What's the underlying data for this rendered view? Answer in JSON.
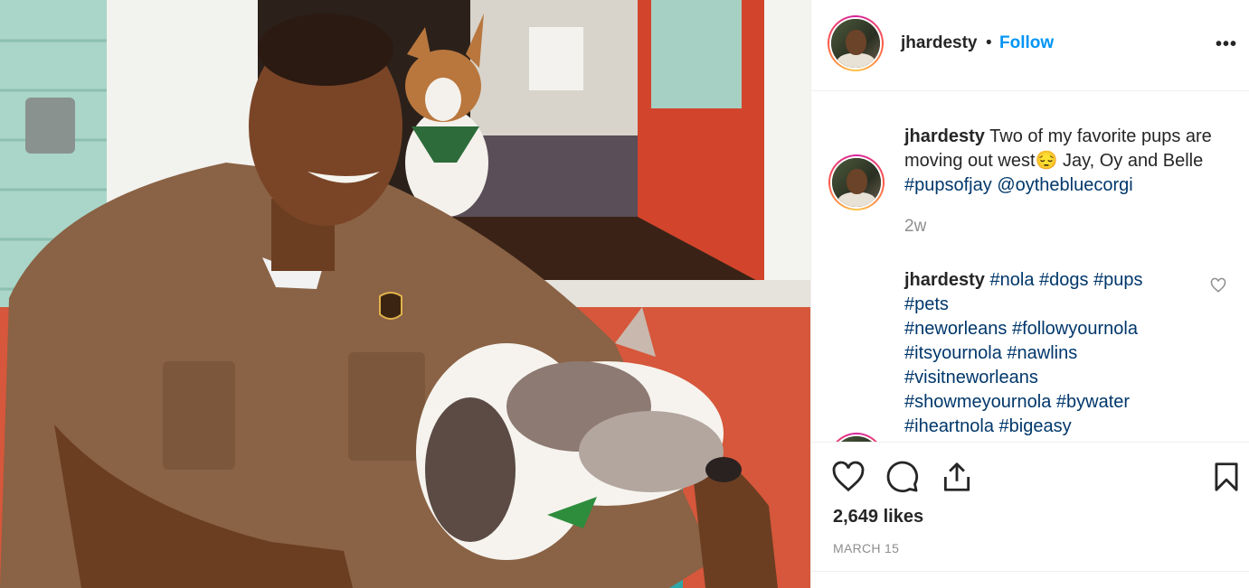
{
  "colors": {
    "link_blue": "#0095f6",
    "hashtag": "#00376b",
    "muted": "#8e8e8e",
    "text": "#262626"
  },
  "header": {
    "username": "jhardesty",
    "separator": "•",
    "follow_label": "Follow",
    "more_icon": "more-options-icon",
    "more_label": "•••"
  },
  "caption": {
    "username": "jhardesty",
    "text_part1": " Two of my favorite pups are moving out west",
    "emoji": "😔",
    "text_part2": " Jay, Oy and Belle ",
    "hashtag": "#pupsofjay",
    "mention": "@oythebluecorgi",
    "time": "2w"
  },
  "comment": {
    "username": "jhardesty",
    "tags": [
      "#nola",
      "#dogs",
      "#pups",
      "#pets",
      "#neworleans",
      "#followyournola",
      "#itsyournola",
      "#nawlins",
      "#visitneworleans",
      "#showmeyournola",
      "#bywater",
      "#iheartnola",
      "#bigeasy"
    ]
  },
  "actions": {
    "icons": [
      "heart-icon",
      "comment-icon",
      "share-icon",
      "bookmark-icon"
    ],
    "likes": "2,649 likes",
    "date": "MARCH 15"
  }
}
